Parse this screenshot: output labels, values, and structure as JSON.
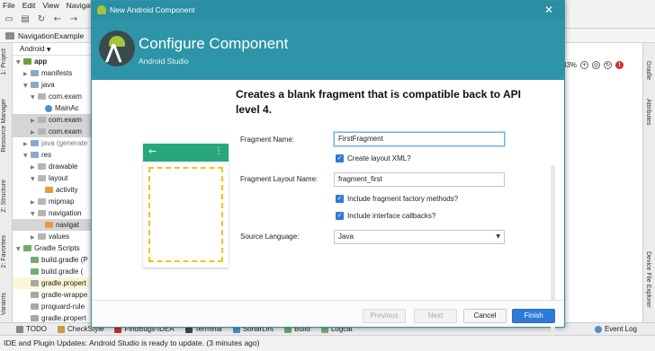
{
  "menu": [
    "File",
    "Edit",
    "View",
    "Navigate"
  ],
  "navbar": {
    "project": "NavigationExample"
  },
  "left_tabs": [
    "1: Project",
    "Resource Manager",
    "Z: Structure",
    "2: Favorites",
    "Variants"
  ],
  "project_panel": {
    "view": "Android",
    "tree": [
      "app",
      "manifests",
      "java",
      "com.exam",
      "MainAc",
      "com.exam",
      "com.exam",
      "java (generate",
      "res",
      "drawable",
      "layout",
      "activity",
      "mipmap",
      "navigation",
      "navigat",
      "values",
      "Gradle Scripts",
      "build.gradle (P",
      "build.gradle (",
      "gradle.propert",
      "gradle-wrappe",
      "proguard-rule",
      "gradle.propert"
    ]
  },
  "zoom": "33%",
  "right_tabs": [
    "Gradle",
    "Attributes",
    "Device File Explorer"
  ],
  "bottom_tools": [
    "TODO",
    "CheckStyle",
    "FindBugs-IDEA",
    "Terminal",
    "SonarLint",
    "Build",
    "Logcat"
  ],
  "event_log": "Event Log",
  "status_text": "IDE and Plugin Updates: Android Studio is ready to update. (3 minutes ago)",
  "dialog": {
    "window_title": "New Android Component",
    "header_title": "Configure Component",
    "header_subtitle": "Android Studio",
    "description": "Creates a blank fragment that is compatible back to API level 4.",
    "labels": {
      "fragment_name": "Fragment Name:",
      "layout_name": "Fragment Layout Name:",
      "source_language": "Source Language:"
    },
    "values": {
      "fragment_name": "FirstFragment",
      "layout_name": "fragment_first",
      "source_language": "Java"
    },
    "checkboxes": {
      "create_layout": "Create layout XML?",
      "factory_methods": "Include fragment factory methods?",
      "interface_callbacks": "Include interface callbacks?"
    },
    "buttons": {
      "previous": "Previous",
      "next": "Next",
      "cancel": "Cancel",
      "finish": "Finish"
    }
  },
  "colors": {
    "dialog_header": "#2e95a8",
    "preview_bar": "#27a77a",
    "fragment_outline": "#f0c419",
    "primary_button": "#2e7bd6",
    "android_green": "#a4c639"
  }
}
